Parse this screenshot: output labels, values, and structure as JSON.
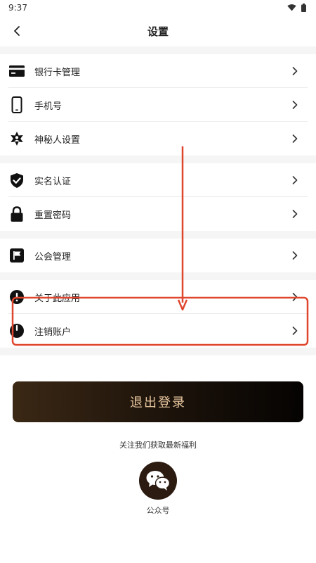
{
  "status_bar": {
    "time": "9:37"
  },
  "header": {
    "title": "设置"
  },
  "settings": {
    "bank_card": "银行卡管理",
    "phone": "手机号",
    "mystery": "神秘人设置",
    "real_name": "实名认证",
    "reset_password": "重置密码",
    "guild": "公会管理",
    "about": "关于此应用",
    "cancel_account": "注销账户"
  },
  "logout_label": "退出登录",
  "follow_text": "关注我们获取最新福利",
  "wechat_label": "公众号",
  "icons": {
    "back": "chevron-left-icon",
    "chevron": "chevron-right-icon",
    "bank_card": "credit-card-icon",
    "phone": "phone-icon",
    "mystery": "mystery-person-icon",
    "real_name": "shield-check-icon",
    "reset_password": "lock-icon",
    "guild": "flag-icon",
    "about": "info-icon",
    "cancel_account": "power-icon",
    "wechat": "wechat-icon"
  },
  "colors": {
    "annotation": "#e0452e",
    "logout_text": "#e9c7a0",
    "logout_bg_start": "#3b2815",
    "logout_bg_end": "#050302",
    "wechat_bg": "#2b1b10"
  }
}
